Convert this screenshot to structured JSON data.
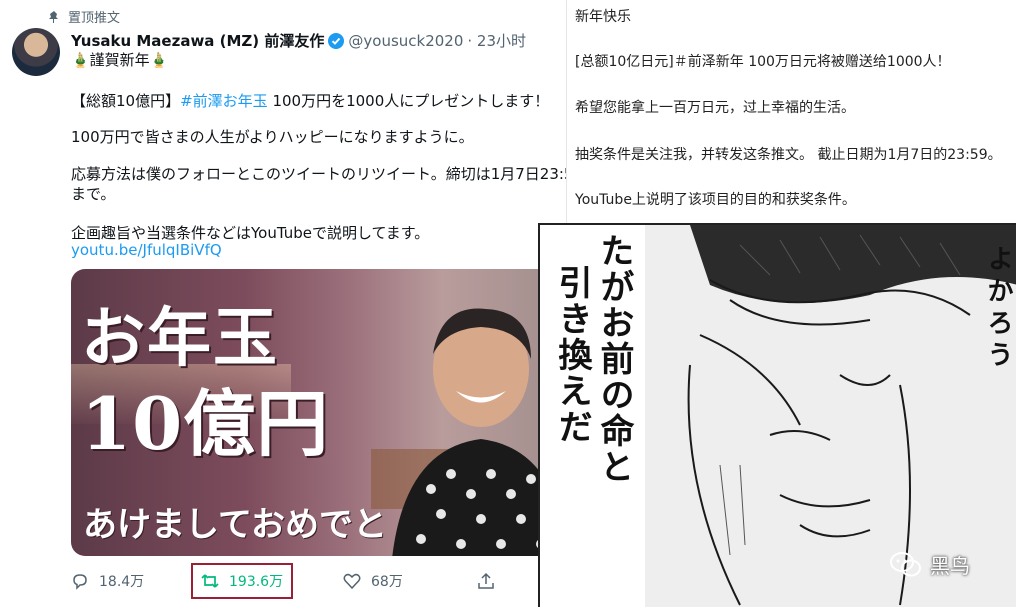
{
  "tweet": {
    "pinned_label": "置顶推文",
    "name": "Yusaku Maezawa (MZ) 前澤友作",
    "handle": "@yousuck2020",
    "time": "· 23小时",
    "greeting": "🎍謹賀新年🎍",
    "line1_prefix": "【総額10億円】",
    "line1_hashtag": "#前澤お年玉",
    "line1_suffix": " 100万円を1000人にプレゼントします！",
    "line2": "100万円で皆さまの人生がよりハッピーになりますように。",
    "line3": "応募方法は僕のフォローとこのツイートのリツイート。締切は1月7日23:5",
    "line3b": "まで。",
    "line4": "企画趣旨や当選条件などはYouTubeで説明してます。",
    "link": "youtu.be/JfulqIBiVfQ",
    "media_title1": "お年玉",
    "media_title2": "10億円",
    "media_title3": "あけましておめでと",
    "actions": {
      "reply_count": "18.4万",
      "retweet_count": "193.6万",
      "like_count": "68万"
    }
  },
  "translation": {
    "line1": "新年快乐",
    "line2": "[总额10亿日元]＃前泽新年 100万日元将被赠送给1000人！",
    "line3": "希望您能拿上一百万日元，过上幸福的生活。",
    "line4": "抽奖条件是关注我，并转发这条推文。 截止日期为1月7日的23:59。",
    "line5": "YouTube上说明了该项目的目的和获奖条件。"
  },
  "manga": {
    "col1": "引き換えだ",
    "col2": "たがお前の命と",
    "col3": "よかろう"
  },
  "watermark": {
    "text": "黑鸟"
  },
  "colors": {
    "link": "#1d9bf0",
    "retweet": "#00ba7c",
    "highlight_box": "#9a2135"
  }
}
